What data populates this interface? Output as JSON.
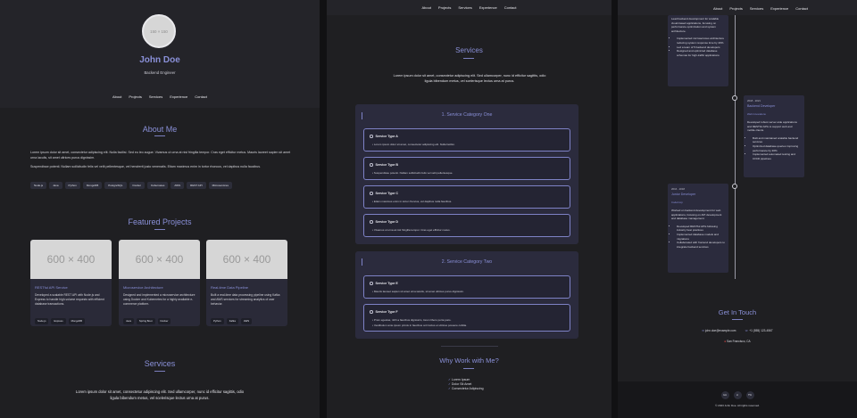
{
  "nav": [
    "About",
    "Projects",
    "Services",
    "Experience",
    "Contact"
  ],
  "profile": {
    "avatar_text": "150 × 150",
    "name": "John Doe",
    "title": "Backend Engineer"
  },
  "about": {
    "title": "About Me",
    "p1": "Lorem ipsum dolor sit amet, consectetur adipiscing elit. Nulla facilisi. Sed eu leo augue. Vivamus ut urna at nisl fringilla tempor. Cras eget efficitur metus. Mauris laoreet sapien sit amet urna iaculis, sit amet ultrices purus dignissim.",
    "p2": "Suspendisse potenti. Nullam sollicitudin felis vel velit pellentesque, vel hendrerit justo venenatis. Etiam maximus enim in tortor rhoncus, vel dapibus nulla faucibus.",
    "skills": [
      "Node.js",
      "Java",
      "Python",
      "MongoDB",
      "PostgreSQL",
      "Docker",
      "Kubernetes",
      "AWS",
      "REST API",
      "Microservices"
    ]
  },
  "projects": {
    "title": "Featured Projects",
    "items": [
      {
        "img": "600 × 400",
        "title": "RESTful API Service",
        "desc": "Developed a scalable REST API with Node.js and Express to handle high-volume requests with efficient database transactions.",
        "tags": [
          "Node.js",
          "Express",
          "MongoDB"
        ]
      },
      {
        "img": "600 × 400",
        "title": "Microservice Architecture",
        "desc": "Designed and implemented a microservice architecture using Docker and Kubernetes for a highly available e-commerce platform.",
        "tags": [
          "Java",
          "Spring Boot",
          "Docker"
        ]
      },
      {
        "img": "600 × 400",
        "title": "Real-time Data Pipeline",
        "desc": "Built a real-time data processing pipeline using Kafka and AWS services for streaming analytics of user behavior.",
        "tags": [
          "Python",
          "Kafka",
          "AWS"
        ]
      }
    ]
  },
  "services": {
    "title": "Services",
    "lead": "Lorem ipsum dolor sit amet, consectetur adipiscing elit. Sed ullamcorper, nunc id efficitur sagittis, odio ligula bibendum metus, vel scelerisque lectus urna at purus.",
    "categories": [
      {
        "title": "1. Service Category One",
        "items": [
          {
            "name": "Service Type A",
            "desc": "Lorem ipsum dolor sit amet, consectetur adipiscing elit. Nulla facilisi."
          },
          {
            "name": "Service Type B",
            "desc": "Suspendisse potenti. Nullam sollicitudin felis vel velit pellentesque."
          },
          {
            "name": "Service Type C",
            "desc": "Etiam maximus enim in tortor rhoncus, vel dapibus nulla faucibus."
          },
          {
            "name": "Service Type D",
            "desc": "Vivamus ut urna at nisl fringilla tempor. Cras eget efficitur metus."
          }
        ]
      },
      {
        "title": "2. Service Category Two",
        "items": [
          {
            "name": "Service Type E",
            "desc": "Mauris laoreet sapien sit amet urna iaculis, sit amet ultrices purus dignissim."
          },
          {
            "name": "Service Type F",
            "desc": "Proin egestas, nibh a faucibus dignissim, lorem libero porta justo.",
            "desc2": "Vestibulum ante ipsum primis in faucibus orci luctus et ultrices posuere cubilia."
          }
        ]
      }
    ]
  },
  "why": {
    "title": "Why Work with Me?",
    "points": [
      "Lorem Ipsum",
      "Dolor Sit Amet",
      "Consectetur Adipiscing"
    ]
  },
  "experience": {
    "top": {
      "desc": "Lead backend development for scalable cloud-based applications, focusing on performance optimization and system architecture.",
      "bullets": [
        "Implemented microservices architecture reducing system response time by 40%",
        "Led a team of 5 backend developers",
        "Designed and optimized database schemas for high-traffic applications"
      ]
    },
    "mid": {
      "dates": "2018 - 2021",
      "role": "Backend Developer",
      "company": "Web Innovations",
      "desc": "Developed robust server-side applications and RESTful APIs to support web and mobile clients.",
      "bullets": [
        "Built and maintained scalable backend services",
        "Optimized database queries improving performance by 30%",
        "Implemented automated testing and CI/CD pipelines"
      ]
    },
    "bottom": {
      "dates": "2016 - 2018",
      "role": "Junior Developer",
      "company": "CodeCorp",
      "desc": "Worked on backend development for web applications, focusing on API development and database management.",
      "bullets": [
        "Developed RESTful APIs following industry best practices",
        "Implemented database models and migrations",
        "Collaborated with frontend developers to integrate backend services"
      ]
    }
  },
  "contact": {
    "title": "Get In Touch",
    "email": "john.doe@example.com",
    "phone": "+1 (555) 123-4567",
    "location": "San Francisco, CA"
  },
  "footer": {
    "socials": [
      "GH",
      "LI",
      "TW"
    ],
    "copyright": "© 2023 John Doe. All rights reserved."
  }
}
